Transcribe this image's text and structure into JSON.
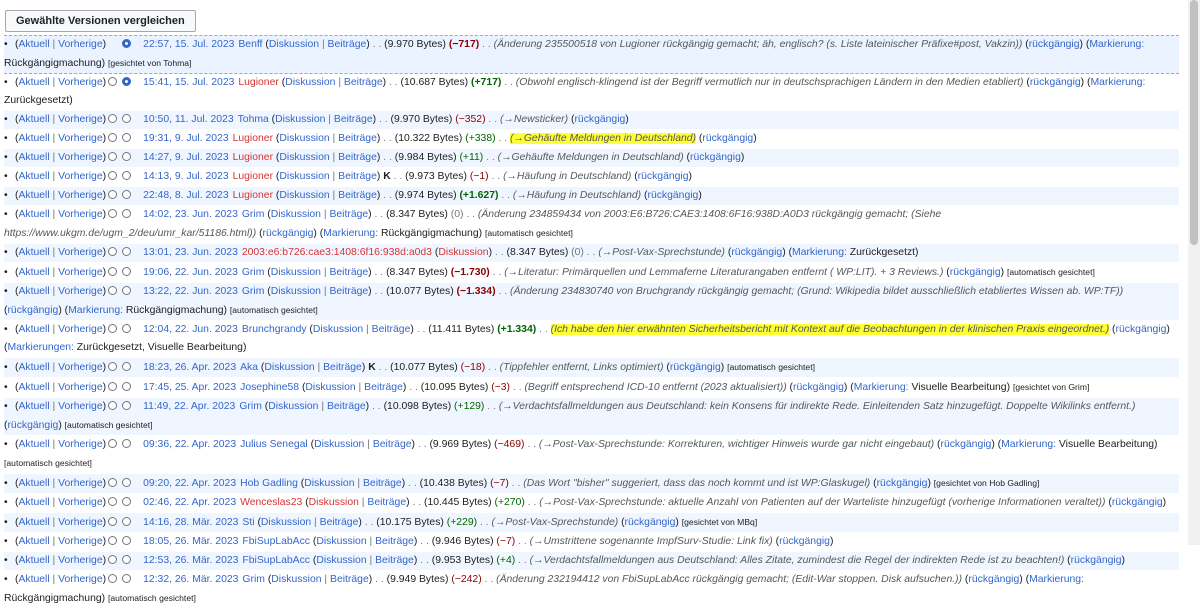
{
  "compare_button": "Gewählte Versionen vergleichen",
  "labels": {
    "current": "Aktuell",
    "previous": "Vorherige",
    "talk": "Diskussion",
    "contribs": "Beiträge",
    "undo": "rückgängig",
    "tag_prefix": "Markierung:",
    "tags_prefix": "Markierungen:",
    "auto_sighted": "[automatisch gesichtet]",
    "sighted_by": "gesichtet von"
  },
  "rows": [
    {
      "date": "22:57, 15. Jul. 2023",
      "user": "Benff",
      "size": "(9.970 Bytes)",
      "diff": "(−717)",
      "diffclass": "neg bold",
      "comment": "(Änderung 235500518 von Lugioner rückgängig gemacht; äh, englisch? (s. Liste lateinischer Präfixe#post, Vakzin))",
      "tag": "Rückgängigmachung",
      "extra": "[gesichtet von Tohma]",
      "selected": true
    },
    {
      "date": "15:41, 15. Jul. 2023",
      "user": "Lugioner",
      "usered": true,
      "size": "(10.687 Bytes)",
      "diff": "(+717)",
      "diffclass": "pos bold",
      "comment": "(Obwohl englisch-klingend ist der Begriff vermutlich nur in deutschsprachigen Ländern in den Medien etabliert)",
      "tag": "Zurückgesetzt"
    },
    {
      "date": "10:50, 11. Jul. 2023",
      "user": "Tohma",
      "size": "(9.970 Bytes)",
      "diff": "(−352)",
      "diffclass": "neg",
      "comment": "(→Newsticker)"
    },
    {
      "date": "19:31, 9. Jul. 2023",
      "user": "Lugioner",
      "usered": true,
      "size": "(10.322 Bytes)",
      "diff": "(+338)",
      "diffclass": "pos",
      "comment": "(→Gehäufte Meldungen in Deutschland)",
      "hl": true
    },
    {
      "date": "14:27, 9. Jul. 2023",
      "user": "Lugioner",
      "usered": true,
      "size": "(9.984 Bytes)",
      "diff": "(+11)",
      "diffclass": "pos",
      "comment": "(→Gehäufte Meldungen in Deutschland)"
    },
    {
      "date": "14:13, 9. Jul. 2023",
      "user": "Lugioner",
      "usered": true,
      "minor": "K",
      "size": "(9.973 Bytes)",
      "diff": "(−1)",
      "diffclass": "neg",
      "comment": "(→Häufung in Deutschland)"
    },
    {
      "date": "22:48, 8. Jul. 2023",
      "user": "Lugioner",
      "usered": true,
      "size": "(9.974 Bytes)",
      "diff": "(+1.627)",
      "diffclass": "pos bold",
      "comment": "(→Häufung in Deutschland)"
    },
    {
      "date": "14:02, 23. Jun. 2023",
      "user": "Grim",
      "size": "(8.347 Bytes)",
      "diff": "(0)",
      "diffclass": "gray",
      "comment": "(Änderung 234859434 von 2003:E6:B726:CAE3:1408:6F16:938D:A0D3 rückgängig gemacht; (Siehe https://www.ukgm.de/ugm_2/deu/umr_kar/51186.html))",
      "tag": "Rückgängigmachung",
      "extra": "[automatisch gesichtet]"
    },
    {
      "date": "13:01, 23. Jun. 2023",
      "user": "2003:e6:b726:cae3:1408:6f16:938d:a0d3",
      "ip": true,
      "size": "(8.347 Bytes)",
      "diff": "(0)",
      "diffclass": "gray",
      "comment": "(→Post-Vax-Sprechstunde)",
      "tag": "Zurückgesetzt"
    },
    {
      "date": "19:06, 22. Jun. 2023",
      "user": "Grim",
      "size": "(8.347 Bytes)",
      "diff": "(−1.730)",
      "diffclass": "neg bold",
      "comment": "(→Literatur: Primärquellen und Lemmaferne Literaturangaben entfernt ( WP:LIT). + 3 Reviews.)",
      "extra": "[automatisch gesichtet]"
    },
    {
      "date": "13:22, 22. Jun. 2023",
      "user": "Grim",
      "size": "(10.077 Bytes)",
      "diff": "(−1.334)",
      "diffclass": "neg bold",
      "comment": "(Änderung 234830740 von Bruchgrandy rückgängig gemacht; (Grund: Wikipedia bildet ausschließlich etabliertes Wissen ab. WP:TF))",
      "tag": "Rückgängigmachung",
      "extra": "[automatisch gesichtet]"
    },
    {
      "date": "12:04, 22. Jun. 2023",
      "user": "Brunchgrandy",
      "size": "(11.411 Bytes)",
      "diff": "(+1.334)",
      "diffclass": "pos bold",
      "comment": "(Ich habe den hier erwähnten Sicherheitsbericht mit Kontext auf die Beobachtungen in der klinischen Praxis eingeordnet.)",
      "hl": true,
      "tags": "Zurückgesetzt, Visuelle Bearbeitung"
    },
    {
      "date": "18:23, 26. Apr. 2023",
      "user": "Aka",
      "minor": "K",
      "size": "(10.077 Bytes)",
      "diff": "(−18)",
      "diffclass": "neg",
      "comment": "(Tippfehler entfernt, Links optimiert)",
      "extra": "[automatisch gesichtet]"
    },
    {
      "date": "17:45, 25. Apr. 2023",
      "user": "Josephine58",
      "size": "(10.095 Bytes)",
      "diff": "(−3)",
      "diffclass": "neg",
      "comment": "(Begriff entsprechend ICD-10 entfernt (2023 aktualisiert))",
      "tag": "Visuelle Bearbeitung",
      "extra": "[gesichtet von Grim]"
    },
    {
      "date": "11:49, 22. Apr. 2023",
      "user": "Grim",
      "size": "(10.098 Bytes)",
      "diff": "(+129)",
      "diffclass": "pos",
      "comment": "(→Verdachtsfallmeldungen aus Deutschland: kein Konsens für indirekte Rede. Einleitenden Satz hinzugefügt. Doppelte Wikilinks entfernt.)",
      "extra": "[automatisch gesichtet]"
    },
    {
      "date": "09:36, 22. Apr. 2023",
      "user": "Julius Senegal",
      "size": "(9.969 Bytes)",
      "diff": "(−469)",
      "diffclass": "neg",
      "comment": "(→Post-Vax-Sprechstunde: Korrekturen, wichtiger Hinweis wurde gar nicht eingebaut)",
      "tag": "Visuelle Bearbeitung",
      "extra": "[automatisch gesichtet]"
    },
    {
      "date": "09:20, 22. Apr. 2023",
      "user": "Hob Gadling",
      "size": "(10.438 Bytes)",
      "diff": "(−7)",
      "diffclass": "neg",
      "comment": "(Das Wort \"bisher\" suggeriert, dass das noch kommt und ist WP:Glaskugel)",
      "extra": "[gesichtet von Hob Gadling]"
    },
    {
      "date": "02:46, 22. Apr. 2023",
      "user": "Wenceslas23",
      "usered": true,
      "talkred": true,
      "size": "(10.445 Bytes)",
      "diff": "(+270)",
      "diffclass": "pos",
      "comment": "(→Post-Vax-Sprechstunde: aktuelle Anzahl von Patienten auf der Warteliste hinzugefügt (vorherige Informationen veraltet))"
    },
    {
      "date": "14:16, 28. Mär. 2023",
      "user": "Sti",
      "size": "(10.175 Bytes)",
      "diff": "(+229)",
      "diffclass": "pos",
      "comment": "(→Post-Vax-Sprechstunde)",
      "extra": "[gesichtet von MBq]"
    },
    {
      "date": "18:05, 26. Mär. 2023",
      "user": "FbiSupLabAcc",
      "size": "(9.946 Bytes)",
      "diff": "(−7)",
      "diffclass": "neg",
      "comment": "(→Umstrittene sogenannte ImpfSurv-Studie: Link fix)"
    },
    {
      "date": "12:53, 26. Mär. 2023",
      "user": "FbiSupLabAcc",
      "size": "(9.953 Bytes)",
      "diff": "(+4)",
      "diffclass": "pos",
      "comment": "(→Verdachtsfallmeldungen aus Deutschland: Alles Zitate, zumindest die Regel der indirekten Rede ist zu beachten!)"
    },
    {
      "date": "12:32, 26. Mär. 2023",
      "user": "Grim",
      "size": "(9.949 Bytes)",
      "diff": "(−242)",
      "diffclass": "neg",
      "comment": "(Änderung 232194412 von FbiSupLabAcc rückgängig gemacht; (Edit-War stoppen. Disk aufsuchen.))",
      "tag": "Rückgängigmachung",
      "extra": "[automatisch gesichtet]"
    }
  ]
}
